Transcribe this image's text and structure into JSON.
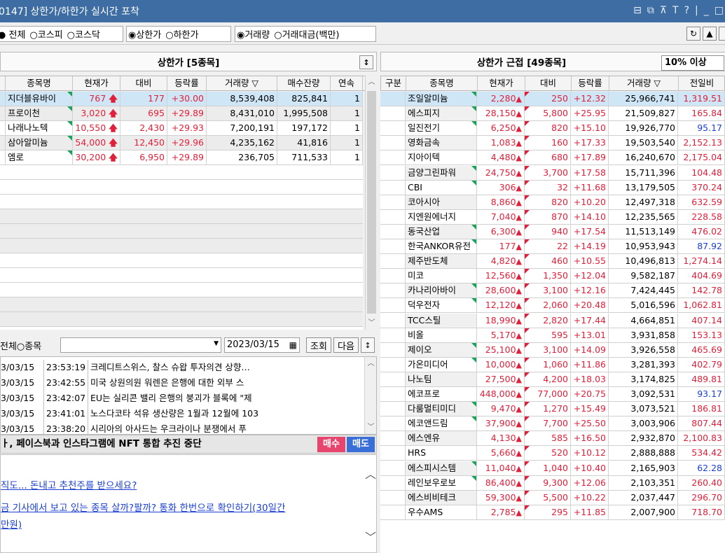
{
  "window": {
    "title": "0147] 상한가/하한가 실시간 포착"
  },
  "toolbar": {
    "opt_all": "전체",
    "opt_kospi": "코스피",
    "opt_kosdaq": "코스닥",
    "opt_upper": "상한가",
    "opt_lower": "하한가",
    "opt_volume": "거래량",
    "opt_amount": "거래대금(백만)"
  },
  "left": {
    "title": "상한가 [5종목]",
    "headers": [
      "종목명",
      "현재가",
      "대비",
      "등락률",
      "거래량 ▽",
      "매수잔량",
      "연속"
    ],
    "rows": [
      [
        "지더블유바이",
        "767",
        "177",
        "+30.00",
        "8,539,408",
        "825,841",
        "1"
      ],
      [
        "프로이천",
        "3,020",
        "695",
        "+29.89",
        "8,431,010",
        "1,995,508",
        "1"
      ],
      [
        "나래나노텍",
        "10,550",
        "2,430",
        "+29.93",
        "7,200,191",
        "197,172",
        "1"
      ],
      [
        "삼아알미늄",
        "54,000",
        "12,450",
        "+29.96",
        "4,235,162",
        "41,816",
        "1"
      ],
      [
        "엠로",
        "30,200",
        "6,950",
        "+29.89",
        "236,705",
        "711,533",
        "1"
      ]
    ]
  },
  "newsbar": {
    "all": "전체",
    "stock": "종목",
    "date": "2023/03/15",
    "query": "조회",
    "next": "다음"
  },
  "news": [
    [
      "3/03/15",
      "23:53:19",
      "크레디트스위스, 찰스 슈왑 투자의견 상향…"
    ],
    [
      "3/03/15",
      "23:42:55",
      "미국 상원의원 워렌은 은행에 대한 외부 스"
    ],
    [
      "3/03/15",
      "23:42:07",
      "EU는 실리콘 밸리 은행의 붕괴가 블록에 \"제"
    ],
    [
      "3/03/15",
      "23:41:01",
      "노스다코타 석유 생산량은 1월과 12월에 103"
    ],
    [
      "3/03/15",
      "23:38:20",
      "시리아의 아사드는 우크라이나 분쟁에서 푸"
    ]
  ],
  "news_title": "ㅏ, 페이스북과 인스타그램에 NFT 통합 추진 중단",
  "buttons": {
    "buy": "매수",
    "sell": "매도"
  },
  "body": {
    "link1": "직도... 돈내고 추천주를 받으세요?",
    "link2": "금 기사에서 보고 있는 종목 살까?팔까? 통화 한번으로 확인하기(30일간",
    "link3": "만원)"
  },
  "right": {
    "title": "상한가 근접 [49종목]",
    "filter": "10% 이상",
    "headers": [
      "구분",
      "종목명",
      "현재가",
      "대비",
      "등락률",
      "거래량 ▽",
      "전일비"
    ],
    "rows": [
      [
        "조일알미늄",
        "2,280",
        "250",
        "+12.32",
        "25,966,741",
        "1,319.51",
        "red"
      ],
      [
        "에스피지",
        "28,150",
        "5,800",
        "+25.95",
        "21,509,827",
        "165.84",
        "red"
      ],
      [
        "일진전기",
        "6,250",
        "820",
        "+15.10",
        "19,926,770",
        "95.17",
        "blue"
      ],
      [
        "영화금속",
        "1,083",
        "160",
        "+17.33",
        "19,503,540",
        "2,152.13",
        "red"
      ],
      [
        "지아이텍",
        "4,480",
        "680",
        "+17.89",
        "16,240,670",
        "2,175.04",
        "red"
      ],
      [
        "금양그린파워",
        "24,750",
        "3,700",
        "+17.58",
        "15,711,396",
        "104.48",
        "red"
      ],
      [
        "CBI",
        "306",
        "32",
        "+11.68",
        "13,179,505",
        "370.24",
        "red"
      ],
      [
        "코아시아",
        "8,860",
        "820",
        "+10.20",
        "12,497,318",
        "632.59",
        "red"
      ],
      [
        "지엔원에너지",
        "7,040",
        "870",
        "+14.10",
        "12,235,565",
        "228.58",
        "red"
      ],
      [
        "동국산업",
        "6,300",
        "940",
        "+17.54",
        "11,513,149",
        "476.02",
        "red"
      ],
      [
        "한국ANKOR유전",
        "177",
        "22",
        "+14.19",
        "10,953,943",
        "87.92",
        "blue"
      ],
      [
        "제주반도체",
        "4,820",
        "460",
        "+10.55",
        "10,496,813",
        "1,274.14",
        "red"
      ],
      [
        "미코",
        "12,560",
        "1,350",
        "+12.04",
        "9,582,187",
        "404.69",
        "red"
      ],
      [
        "카나리아바이",
        "28,600",
        "3,100",
        "+12.16",
        "7,424,445",
        "142.78",
        "red"
      ],
      [
        "덕우전자",
        "12,120",
        "2,060",
        "+20.48",
        "5,016,596",
        "1,062.81",
        "red"
      ],
      [
        "TCC스틸",
        "18,990",
        "2,820",
        "+17.44",
        "4,664,851",
        "407.14",
        "red"
      ],
      [
        "비올",
        "5,170",
        "595",
        "+13.01",
        "3,931,858",
        "153.13",
        "red"
      ],
      [
        "제이오",
        "25,100",
        "3,100",
        "+14.09",
        "3,926,558",
        "465.69",
        "red"
      ],
      [
        "가온미디어",
        "10,000",
        "1,060",
        "+11.86",
        "3,281,393",
        "402.79",
        "red"
      ],
      [
        "나노팀",
        "27,500",
        "4,200",
        "+18.03",
        "3,174,825",
        "489.81",
        "red"
      ],
      [
        "에코프로",
        "448,000",
        "77,000",
        "+20.75",
        "3,092,531",
        "93.17",
        "blue"
      ],
      [
        "다룸멀티미디",
        "9,470",
        "1,270",
        "+15.49",
        "3,073,521",
        "186.81",
        "red"
      ],
      [
        "에코앤드림",
        "37,900",
        "7,700",
        "+25.50",
        "3,003,906",
        "807.44",
        "red"
      ],
      [
        "에스엔유",
        "4,130",
        "585",
        "+16.50",
        "2,932,870",
        "2,100.83",
        "red"
      ],
      [
        "HRS",
        "5,660",
        "520",
        "+10.12",
        "2,888,888",
        "534.42",
        "red"
      ],
      [
        "에스피시스템",
        "11,040",
        "1,040",
        "+10.40",
        "2,165,903",
        "62.28",
        "blue"
      ],
      [
        "레인보우로보",
        "86,400",
        "9,300",
        "+12.06",
        "2,103,351",
        "260.40",
        "red"
      ],
      [
        "에스비비테크",
        "59,300",
        "5,500",
        "+10.22",
        "2,037,447",
        "296.70",
        "red"
      ],
      [
        "우수AMS",
        "2,785",
        "295",
        "+11.85",
        "2,007,900",
        "718.70",
        "red"
      ]
    ]
  }
}
